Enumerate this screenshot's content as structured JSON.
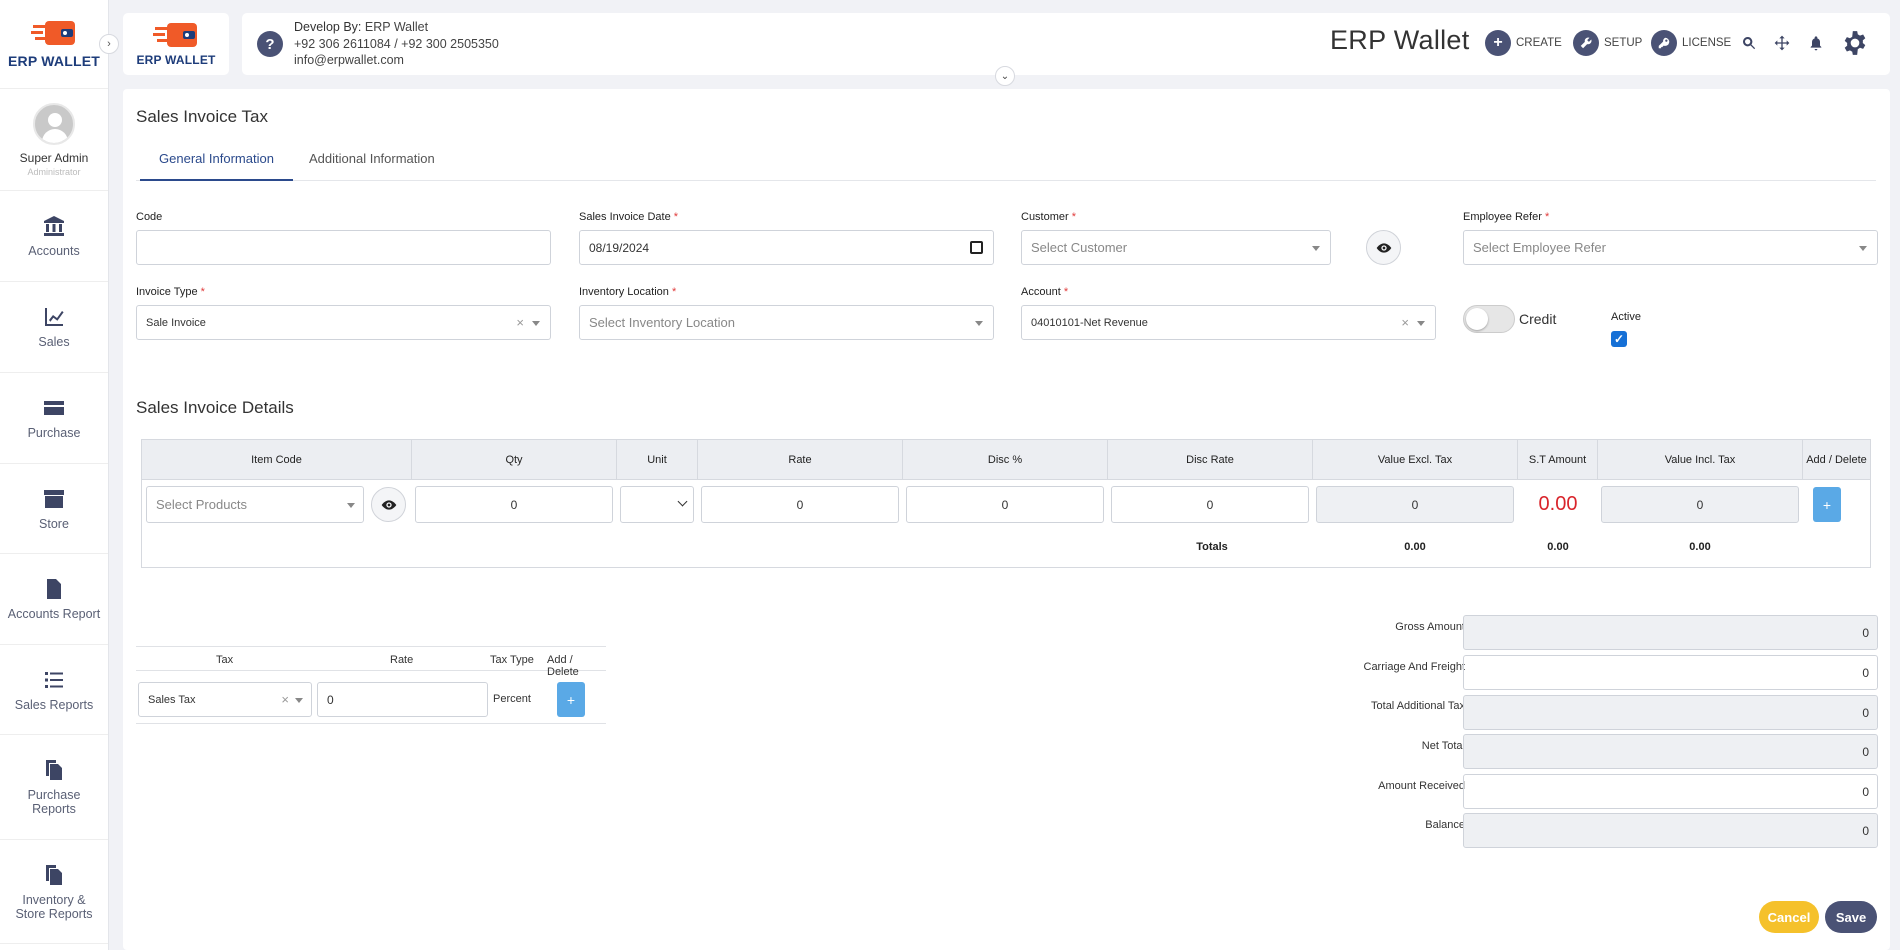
{
  "app": {
    "brand_short": "ERP WALLET",
    "brand_title": "ERP Wallet"
  },
  "developer": {
    "label": "Develop By:",
    "name": "ERP Wallet",
    "phones": "+92 306 2611084 / +92 300 2505350",
    "email": "info@erpwallet.com"
  },
  "header": {
    "help": "?",
    "create": "CREATE",
    "setup": "SETUP",
    "license": "LICENSE"
  },
  "profile": {
    "name": "Super Admin",
    "role": "Administrator"
  },
  "nav": [
    {
      "label": "Accounts",
      "icon": "bank-icon"
    },
    {
      "label": "Sales",
      "icon": "chart-icon"
    },
    {
      "label": "Purchase",
      "icon": "card-icon"
    },
    {
      "label": "Store",
      "icon": "archive-icon"
    },
    {
      "label": "Accounts Report",
      "icon": "document-icon"
    },
    {
      "label": "Sales Reports",
      "icon": "list-icon"
    },
    {
      "label": "Purchase Reports",
      "icon": "copy-icon"
    },
    {
      "label": "Inventory & Store Reports",
      "icon": "copy-icon"
    }
  ],
  "page": {
    "title": "Sales Invoice Tax"
  },
  "tabs": [
    "General Information",
    "Additional Information"
  ],
  "form": {
    "code": {
      "label": "Code",
      "value": ""
    },
    "invoice_date": {
      "label": "Sales Invoice Date",
      "value": "08/19/2024"
    },
    "customer": {
      "label": "Customer",
      "placeholder": "Select Customer"
    },
    "employee": {
      "label": "Employee Refer",
      "placeholder": "Select Employee Refer"
    },
    "invoice_type": {
      "label": "Invoice Type",
      "value": "Sale Invoice"
    },
    "location": {
      "label": "Inventory Location",
      "placeholder": "Select Inventory Location"
    },
    "account": {
      "label": "Account",
      "value": "04010101-Net Revenue"
    },
    "credit": {
      "label": "Credit",
      "on": false
    },
    "active": {
      "label": "Active",
      "checked": true
    },
    "required": "*"
  },
  "details": {
    "title": "Sales Invoice Details",
    "columns": [
      "Item Code",
      "Qty",
      "Unit",
      "Rate",
      "Disc %",
      "Disc Rate",
      "Value Excl. Tax",
      "S.T Amount",
      "Value Incl. Tax",
      "Add / Delete"
    ],
    "row": {
      "product_placeholder": "Select Products",
      "qty": "0",
      "rate": "0",
      "disc_pct": "0",
      "disc_rate": "0",
      "value_excl": "0",
      "st_amount": "0.00",
      "value_incl": "0"
    },
    "totals": {
      "label": "Totals",
      "value_excl": "0.00",
      "st_amount": "0.00",
      "value_incl": "0.00"
    },
    "add": "+"
  },
  "tax": {
    "columns": [
      "Tax",
      "Rate",
      "Tax Type",
      "Add / Delete"
    ],
    "row": {
      "tax": "Sales Tax",
      "rate": "0",
      "type": "Percent"
    },
    "add": "+"
  },
  "summary": [
    {
      "label": "Gross Amount",
      "value": "0",
      "disabled": true
    },
    {
      "label": "Carriage And Freight",
      "value": "0",
      "disabled": false
    },
    {
      "label": "Total Additional Tax",
      "value": "0",
      "disabled": true
    },
    {
      "label": "Net Total",
      "value": "0",
      "disabled": true
    },
    {
      "label": "Amount Received",
      "value": "0",
      "disabled": false
    },
    {
      "label": "Balance",
      "value": "0",
      "disabled": true
    }
  ],
  "actions": {
    "cancel": "Cancel",
    "save": "Save"
  },
  "colors": {
    "accent": "#2b4a8c",
    "brand_orange": "#f05a28",
    "cancel": "#f5c12b",
    "save": "#4a5275",
    "plus": "#5aa9e6",
    "st_red": "#d9242b"
  }
}
